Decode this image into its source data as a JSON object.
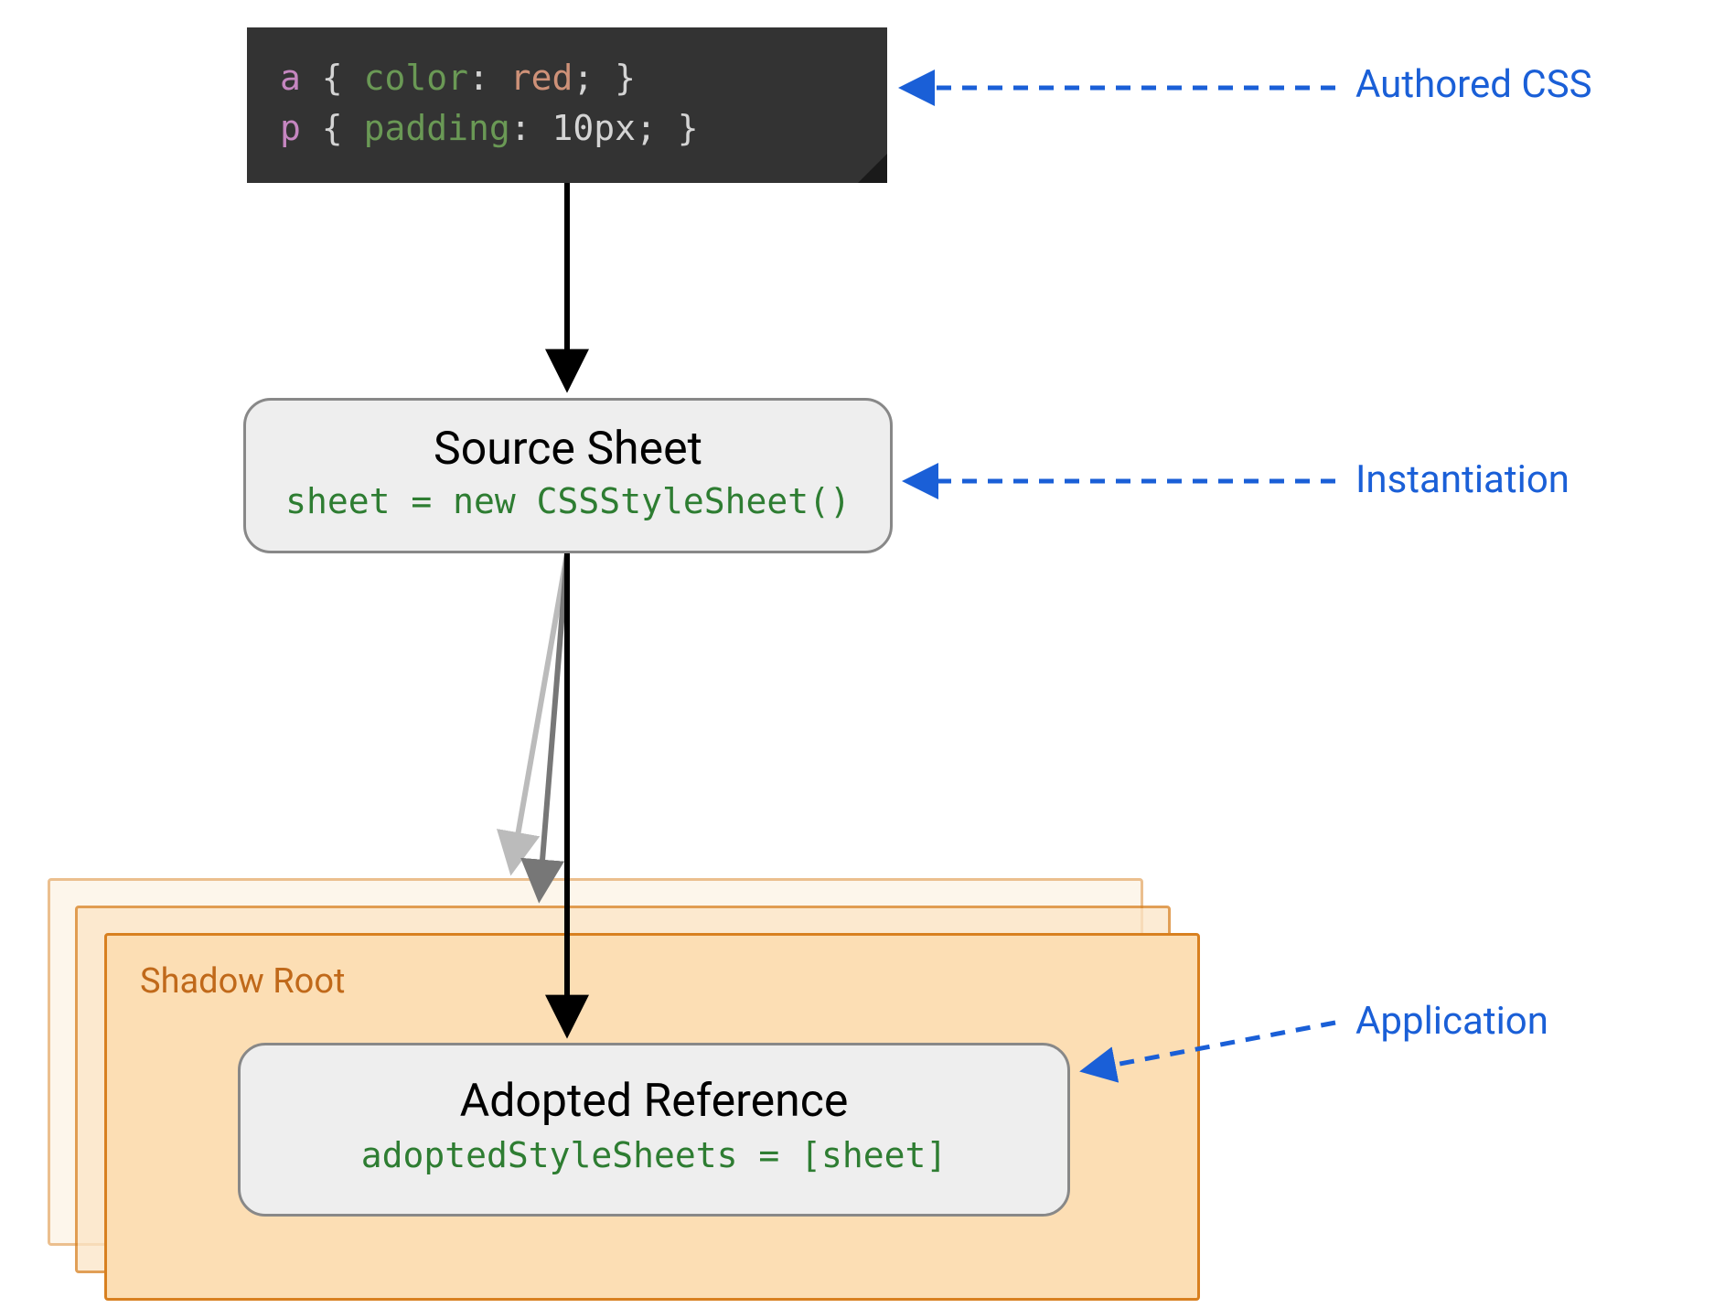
{
  "code": {
    "line1": {
      "selector": "a",
      "brace_open": "{",
      "property": "color",
      "colon": ":",
      "value": "red",
      "semi": ";",
      "brace_close": "}"
    },
    "line2": {
      "selector": "p",
      "brace_open": "{",
      "property": "padding",
      "colon": ":",
      "value": "10px",
      "semi": ";",
      "brace_close": "}"
    }
  },
  "source_sheet": {
    "title": "Source Sheet",
    "code": "sheet = new CSSStyleSheet()"
  },
  "shadow_root": {
    "label": "Shadow Root"
  },
  "adopted_ref": {
    "title": "Adopted Reference",
    "code": "adoptedStyleSheets = [sheet]"
  },
  "annotations": {
    "authored_css": "Authored CSS",
    "instantiation": "Instantiation",
    "application": "Application"
  }
}
